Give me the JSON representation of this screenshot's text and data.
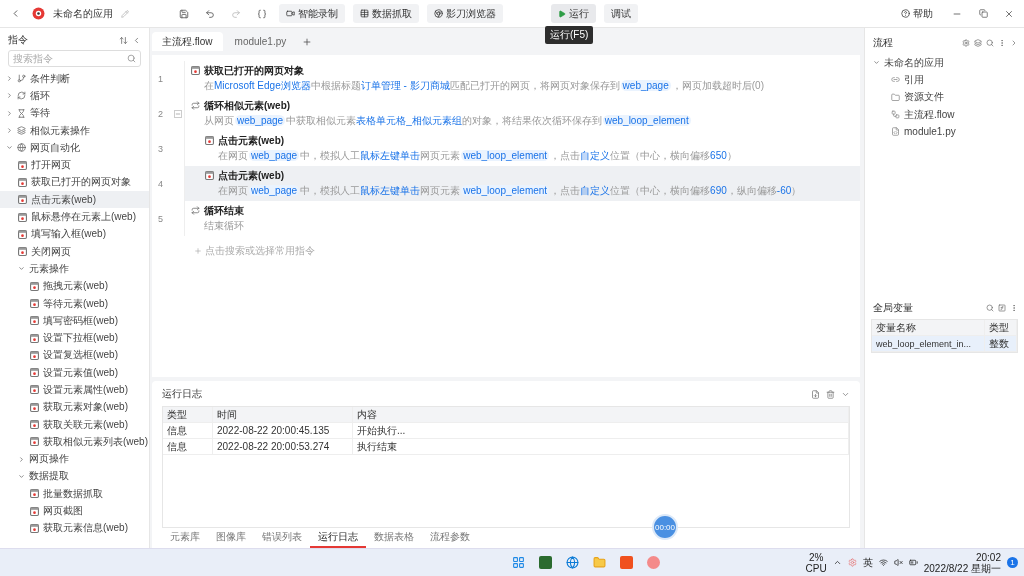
{
  "titlebar": {
    "app_name": "未命名的应用",
    "buttons": [
      {
        "label": "智能录制",
        "kind": "record"
      },
      {
        "label": "数据抓取",
        "kind": "table"
      },
      {
        "label": "影刀浏览器",
        "kind": "browser"
      }
    ],
    "run": {
      "label": "运行",
      "tooltip": "运行(F5)"
    },
    "debug": {
      "label": "调试"
    },
    "help": "帮助"
  },
  "sidebar": {
    "title": "指令",
    "search": {
      "placeholder": "搜索指令"
    },
    "items": [
      {
        "label": "条件判断",
        "expanded": false,
        "selected": false
      },
      {
        "label": "循环",
        "expanded": false,
        "selected": false
      },
      {
        "label": "等待",
        "expanded": false,
        "selected": false
      },
      {
        "label": "相似元素操作",
        "expanded": false,
        "selected": false
      },
      {
        "label": "网页自动化",
        "expanded": true,
        "selected": false,
        "children": [
          {
            "label": "打开网页",
            "selected": false
          },
          {
            "label": "获取已打开的网页对象",
            "selected": false
          },
          {
            "label": "点击元素(web)",
            "selected": true
          },
          {
            "label": "鼠标悬停在元素上(web)",
            "selected": false
          },
          {
            "label": "填写输入框(web)",
            "selected": false
          },
          {
            "label": "关闭网页",
            "selected": false
          },
          {
            "label": "元素操作",
            "expanded": true,
            "selected": false,
            "children": [
              {
                "label": "拖拽元素(web)",
                "selected": false
              },
              {
                "label": "等待元素(web)",
                "selected": false
              },
              {
                "label": "填写密码框(web)",
                "selected": false
              },
              {
                "label": "设置下拉框(web)",
                "selected": false
              },
              {
                "label": "设置复选框(web)",
                "selected": false
              },
              {
                "label": "设置元素值(web)",
                "selected": false
              },
              {
                "label": "设置元素属性(web)",
                "selected": false
              },
              {
                "label": "获取元素对象(web)",
                "selected": false
              },
              {
                "label": "获取关联元素(web)",
                "selected": false
              },
              {
                "label": "获取相似元素列表(web)",
                "selected": false
              }
            ]
          },
          {
            "label": "网页操作",
            "expanded": false,
            "selected": false
          },
          {
            "label": "数据提取",
            "expanded": true,
            "selected": false,
            "children": [
              {
                "label": "批量数据抓取",
                "selected": false
              },
              {
                "label": "网页截图",
                "selected": false
              },
              {
                "label": "获取元素信息(web)",
                "selected": false
              }
            ]
          }
        ]
      }
    ]
  },
  "editor_tabs": [
    {
      "label": "主流程.flow",
      "selected": true
    },
    {
      "label": "module1.py",
      "selected": false
    }
  ],
  "flow": {
    "steps": [
      {
        "line": "1",
        "kind": "web",
        "title": "获取已打开的网页对象",
        "selected": false,
        "description": [
          {
            "text": "在",
            "kind": "plain"
          },
          {
            "text": "Microsoft Edge浏览器",
            "kind": "link"
          },
          {
            "text": "中根据标题",
            "kind": "plain"
          },
          {
            "text": "订单管理 - 影刀商城",
            "kind": "link"
          },
          {
            "text": "匹配已打开的网页，将网页对象保存到",
            "kind": "plain"
          },
          {
            "text": "web_page",
            "kind": "var"
          },
          {
            "text": "，网页加载超时后(0)",
            "kind": "plain"
          }
        ]
      },
      {
        "line": "2",
        "kind": "loop",
        "title": "循环相似元素(web)",
        "selected": false,
        "expanded": true,
        "description": [
          {
            "text": "从网页",
            "kind": "plain"
          },
          {
            "text": "web_page",
            "kind": "var"
          },
          {
            "text": "中获取相似元素",
            "kind": "plain"
          },
          {
            "text": "表格单元格_相似元素组",
            "kind": "link"
          },
          {
            "text": "的对象，将结果依次循环保存到",
            "kind": "plain"
          },
          {
            "text": "web_loop_element",
            "kind": "var"
          }
        ],
        "children": [
          {
            "line": "3",
            "kind": "click",
            "title": "点击元素(web)",
            "selected": false,
            "description": [
              {
                "text": "在网页",
                "kind": "plain"
              },
              {
                "text": "web_page",
                "kind": "var"
              },
              {
                "text": "中，模拟人工",
                "kind": "plain"
              },
              {
                "text": "鼠标左键单击",
                "kind": "link"
              },
              {
                "text": "网页元素",
                "kind": "plain"
              },
              {
                "text": "web_loop_element",
                "kind": "var"
              },
              {
                "text": "，点击",
                "kind": "plain"
              },
              {
                "text": "自定义",
                "kind": "link"
              },
              {
                "text": "位置（中心，横向偏移",
                "kind": "plain"
              },
              {
                "text": "650",
                "kind": "link"
              },
              {
                "text": "）",
                "kind": "plain"
              }
            ]
          },
          {
            "line": "4",
            "kind": "click",
            "title": "点击元素(web)",
            "selected": true,
            "description": [
              {
                "text": "在网页",
                "kind": "plain"
              },
              {
                "text": "web_page",
                "kind": "var"
              },
              {
                "text": "中，模拟人工",
                "kind": "plain"
              },
              {
                "text": "鼠标左键单击",
                "kind": "link"
              },
              {
                "text": "网页元素",
                "kind": "plain"
              },
              {
                "text": "web_loop_element",
                "kind": "var"
              },
              {
                "text": "，点击",
                "kind": "plain"
              },
              {
                "text": "自定义",
                "kind": "link"
              },
              {
                "text": "位置（中心，横向偏移",
                "kind": "plain"
              },
              {
                "text": "690",
                "kind": "link"
              },
              {
                "text": "，纵向偏移",
                "kind": "plain"
              },
              {
                "text": "-60",
                "kind": "link"
              },
              {
                "text": "）",
                "kind": "plain"
              }
            ]
          }
        ]
      },
      {
        "line": "5",
        "kind": "loop",
        "title": "循环结束",
        "selected": false,
        "description": [
          {
            "text": "结束循环",
            "kind": "plain"
          }
        ]
      }
    ],
    "add_hint": "点击搜索或选择常用指令"
  },
  "log": {
    "title": "运行日志",
    "columns": [
      "类型",
      "时间",
      "内容"
    ],
    "rows": [
      [
        "信息",
        "2022-08-22 20:00:45.135",
        "开始执行..."
      ],
      [
        "信息",
        "2022-08-22 20:00:53.274",
        "执行结束"
      ]
    ],
    "tabs": [
      {
        "label": "元素库",
        "selected": false
      },
      {
        "label": "图像库",
        "selected": false
      },
      {
        "label": "错误列表",
        "selected": false
      },
      {
        "label": "运行日志",
        "selected": true
      },
      {
        "label": "数据表格",
        "selected": false
      },
      {
        "label": "流程参数",
        "selected": false
      }
    ],
    "timer": "00:00"
  },
  "flow_panel": {
    "title": "流程",
    "root": {
      "label": "未命名的应用",
      "expanded": true,
      "children": [
        {
          "label": "引用"
        },
        {
          "label": "资源文件"
        },
        {
          "label": "主流程.flow"
        },
        {
          "label": "module1.py"
        }
      ]
    }
  },
  "variables": {
    "title": "全局变量",
    "columns": [
      "变量名称",
      "类型"
    ],
    "rows": [
      {
        "name": "web_loop_element_in...",
        "type": "整数",
        "selected": true
      }
    ]
  },
  "taskbar": {
    "cpu": {
      "value": "2%",
      "label": "CPU"
    },
    "ime": "英",
    "time": "20:02",
    "date": "2022/8/22 星期一",
    "badge": "1"
  }
}
